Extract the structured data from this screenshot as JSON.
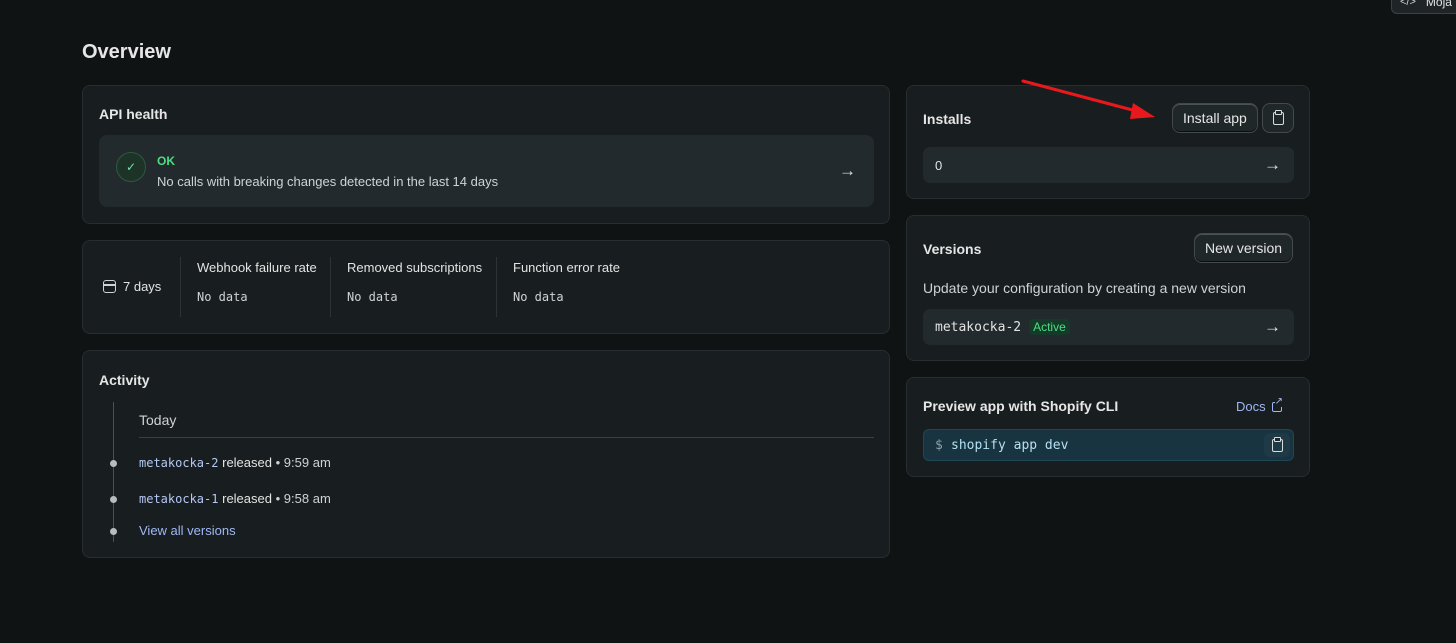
{
  "corner": {
    "label": "Moja"
  },
  "page": {
    "title": "Overview"
  },
  "api_health": {
    "title": "API health",
    "status": "OK",
    "message": "No calls with breaking changes detected in the last 14 days"
  },
  "metrics": {
    "range_label": "7 days",
    "items": [
      {
        "label": "Webhook failure rate",
        "value": "No data"
      },
      {
        "label": "Removed subscriptions",
        "value": "No data"
      },
      {
        "label": "Function error rate",
        "value": "No data"
      }
    ]
  },
  "activity": {
    "title": "Activity",
    "group_label": "Today",
    "events": [
      {
        "version": "metakocka-2",
        "action": "released",
        "time": "9:59 am"
      },
      {
        "version": "metakocka-1",
        "action": "released",
        "time": "9:58 am"
      }
    ],
    "view_all_label": "View all versions",
    "separator": "•"
  },
  "installs": {
    "title": "Installs",
    "install_button": "Install app",
    "count": "0"
  },
  "versions": {
    "title": "Versions",
    "new_button": "New version",
    "description": "Update your configuration by creating a new version",
    "current": "metakocka-2",
    "status_badge": "Active"
  },
  "preview": {
    "title": "Preview app with Shopify CLI",
    "docs_label": "Docs",
    "prompt": "$",
    "command": "shopify app dev"
  },
  "colors": {
    "background": "#0f1314",
    "card": "#181d1f",
    "ok_green": "#4ade80",
    "link_blue": "#9fb8f5",
    "annotation_red": "#e8191d"
  }
}
